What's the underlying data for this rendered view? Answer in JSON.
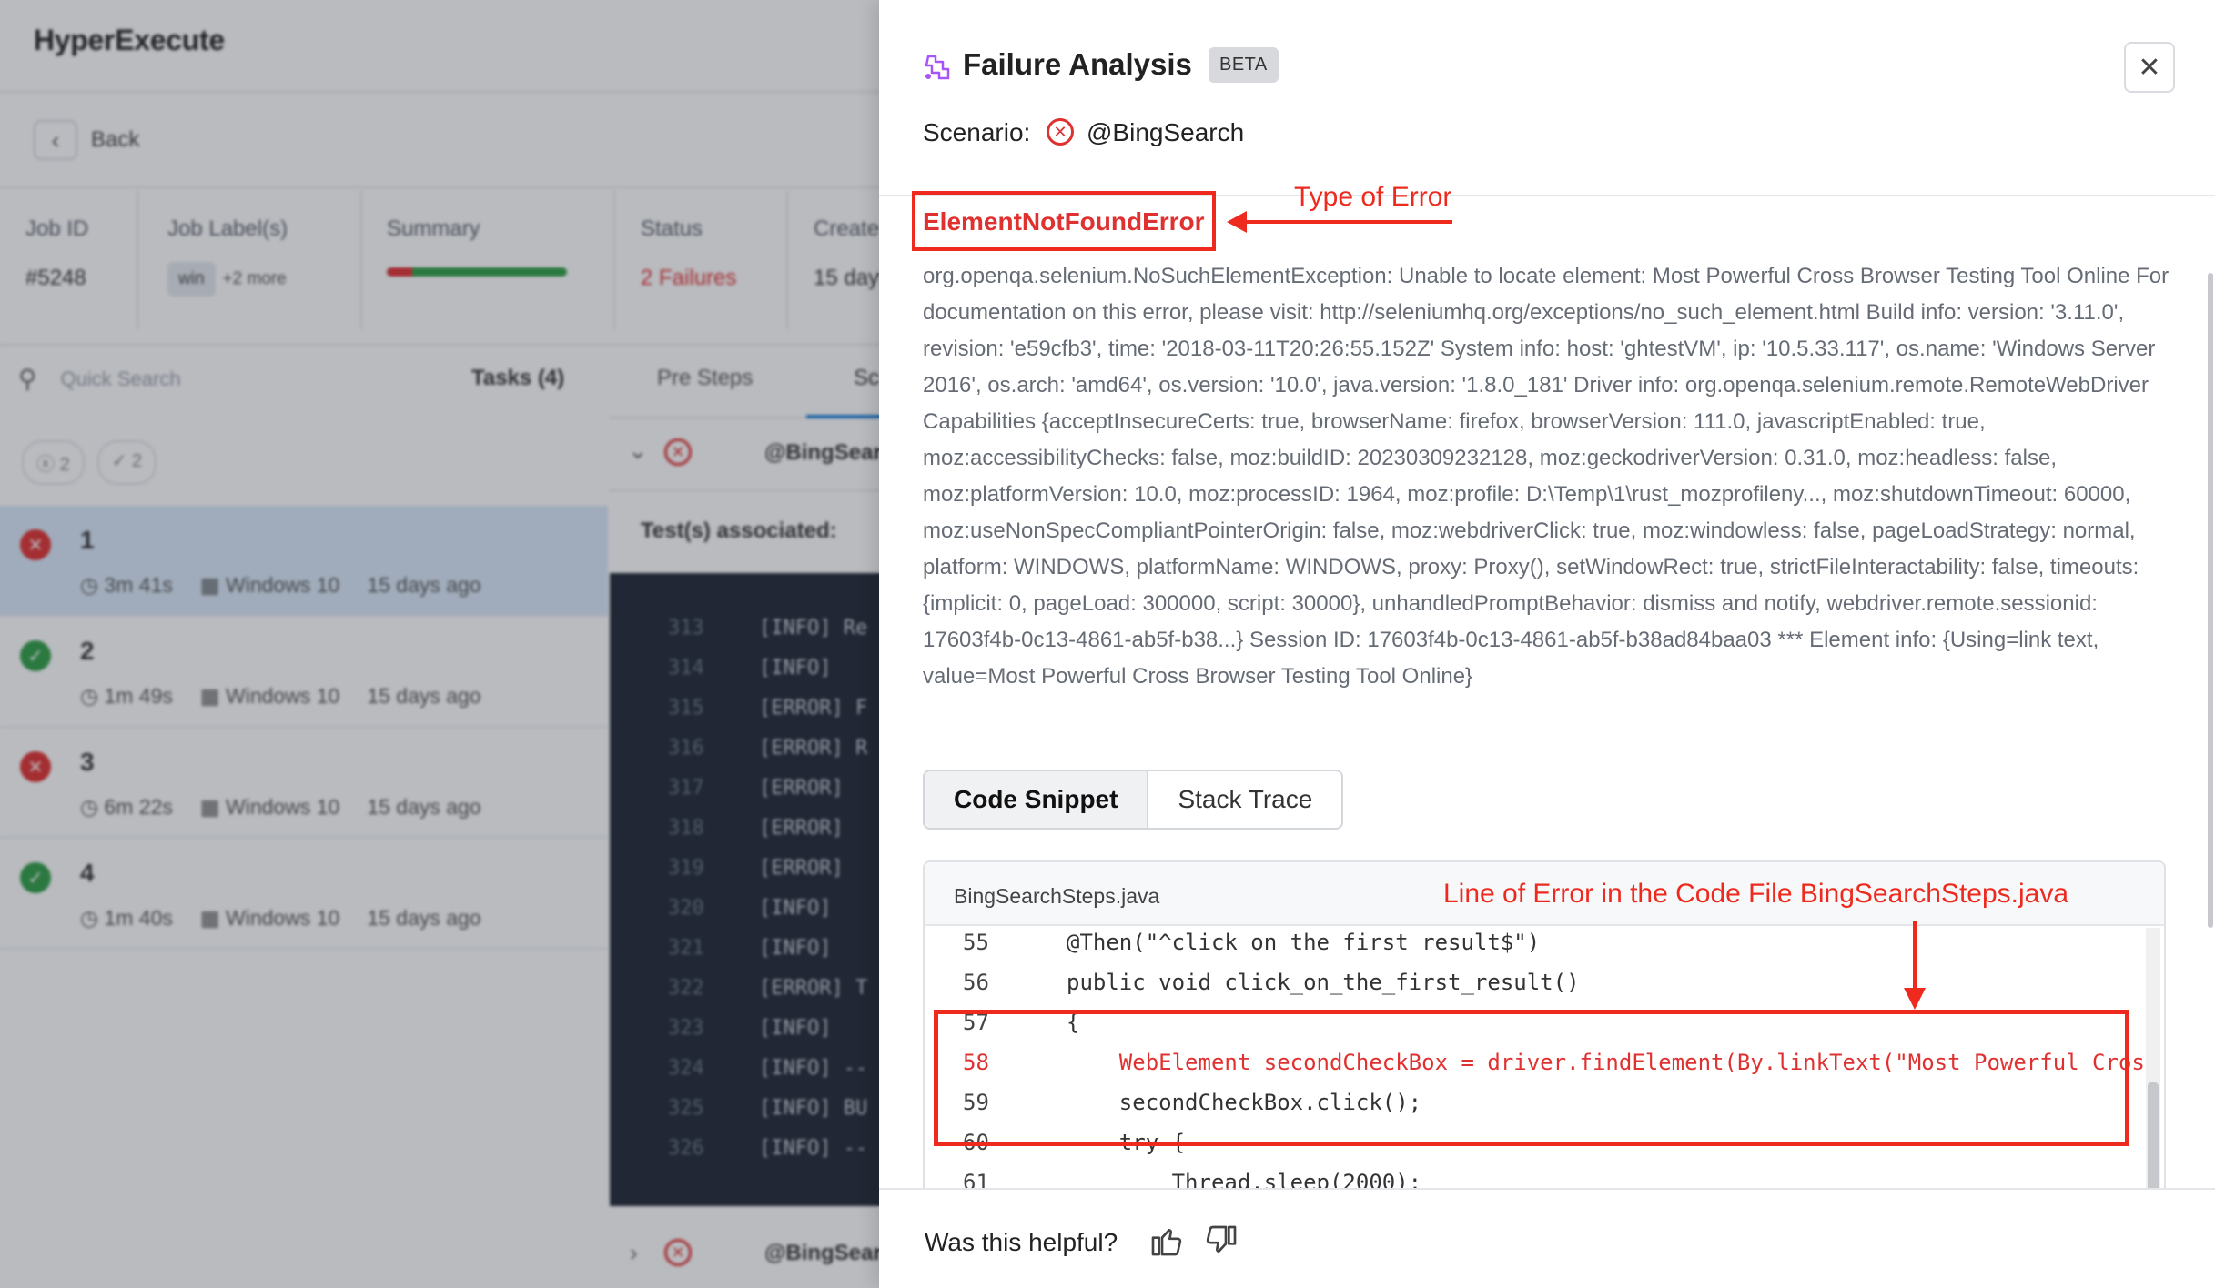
{
  "app": {
    "brand": "HyperExecute",
    "back_label": "Back",
    "meta": {
      "job_id_label": "Job ID",
      "job_id_value": "#5248",
      "job_labels_label": "Job Label(s)",
      "label_chip": "win",
      "label_more": "+2 more",
      "summary_label": "Summary",
      "status_label": "Status",
      "status_value": "2 Failures",
      "created_label": "Create",
      "created_value": "15 day"
    },
    "search_placeholder": "Quick Search",
    "tasks_label": "Tasks (4)",
    "filter_fail_count": "2",
    "filter_pass_count": "2",
    "tabs": {
      "pre_steps": "Pre Steps",
      "scenarios": "Sc"
    },
    "scenario_row_name": "@BingSear",
    "tests_associated": "Test(s) associated:",
    "tasks": [
      {
        "num": "1",
        "duration": "3m 41s",
        "os": "Windows 10",
        "age": "15 days ago",
        "status": "fail"
      },
      {
        "num": "2",
        "duration": "1m 49s",
        "os": "Windows 10",
        "age": "15 days ago",
        "status": "pass"
      },
      {
        "num": "3",
        "duration": "6m 22s",
        "os": "Windows 10",
        "age": "15 days ago",
        "status": "fail"
      },
      {
        "num": "4",
        "duration": "1m 40s",
        "os": "Windows 10",
        "age": "15 days ago",
        "status": "pass"
      }
    ],
    "console_lines": [
      {
        "n": "313",
        "t": "[INFO] Re"
      },
      {
        "n": "314",
        "t": "[INFO]"
      },
      {
        "n": "315",
        "t": "[ERROR] F"
      },
      {
        "n": "316",
        "t": "[ERROR] R"
      },
      {
        "n": "317",
        "t": "[ERROR]"
      },
      {
        "n": "318",
        "t": "[ERROR]"
      },
      {
        "n": "319",
        "t": "[ERROR]"
      },
      {
        "n": "320",
        "t": "[INFO]"
      },
      {
        "n": "321",
        "t": "[INFO]"
      },
      {
        "n": "322",
        "t": "[ERROR] T"
      },
      {
        "n": "323",
        "t": "[INFO]"
      },
      {
        "n": "324",
        "t": "[INFO] --"
      },
      {
        "n": "325",
        "t": "[INFO] BU"
      },
      {
        "n": "326",
        "t": "[INFO] --"
      }
    ],
    "bottom_row_name": "@BingSear"
  },
  "drawer": {
    "title": "Failure Analysis",
    "beta": "BETA",
    "scenario_label": "Scenario:",
    "scenario_name": "@BingSearch",
    "error_type": "ElementNotFoundError",
    "annotation_type": "Type of Error",
    "error_message": "org.openqa.selenium.NoSuchElementException: Unable to locate element: Most Powerful Cross Browser Testing Tool Online For documentation on this error, please visit: http://seleniumhq.org/exceptions/no_such_element.html Build info: version: '3.11.0', revision: 'e59cfb3', time: '2018-03-11T20:26:55.152Z' System info: host: 'ghtestVM', ip: '10.5.33.117', os.name: 'Windows Server 2016', os.arch: 'amd64', os.version: '10.0', java.version: '1.8.0_181' Driver info: org.openqa.selenium.remote.RemoteWebDriver Capabilities {acceptInsecureCerts: true, browserName: firefox, browserVersion: 111.0, javascriptEnabled: true, moz:accessibilityChecks: false, moz:buildID: 20230309232128, moz:geckodriverVersion: 0.31.0, moz:headless: false, moz:platformVersion: 10.0, moz:processID: 1964, moz:profile: D:\\Temp\\1\\rust_mozprofileny..., moz:shutdownTimeout: 60000, moz:useNonSpecCompliantPointerOrigin: false, moz:webdriverClick: true, moz:windowless: false, pageLoadStrategy: normal, platform: WINDOWS, platformName: WINDOWS, proxy: Proxy(), setWindowRect: true, strictFileInteractability: false, timeouts: {implicit: 0, pageLoad: 300000, script: 30000}, unhandledPromptBehavior: dismiss and notify, webdriver.remote.sessionid: 17603f4b-0c13-4861-ab5f-b38...} Session ID: 17603f4b-0c13-4861-ab5f-b38ad84baa03 *** Element info: {Using=link text, value=Most Powerful Cross Browser Testing Tool Online}",
    "tabs": {
      "code_snippet": "Code Snippet",
      "stack_trace": "Stack Trace"
    },
    "code_file": "BingSearchSteps.java",
    "annotation_line": "Line of Error in the Code File BingSearchSteps.java",
    "code_lines": [
      {
        "n": "55",
        "c": "@Then(\"^click on the first result$\")",
        "hl": false
      },
      {
        "n": "56",
        "c": "public void click_on_the_first_result()",
        "hl": false
      },
      {
        "n": "57",
        "c": "{",
        "hl": false
      },
      {
        "n": "58",
        "c": "    WebElement secondCheckBox = driver.findElement(By.linkText(\"Most Powerful Cros",
        "hl": true
      },
      {
        "n": "59",
        "c": "    secondCheckBox.click();",
        "hl": false
      },
      {
        "n": "60",
        "c": "    try {",
        "hl": false
      },
      {
        "n": "61",
        "c": "        Thread.sleep(2000);",
        "hl": false
      }
    ],
    "helpful_question": "Was this helpful?"
  }
}
